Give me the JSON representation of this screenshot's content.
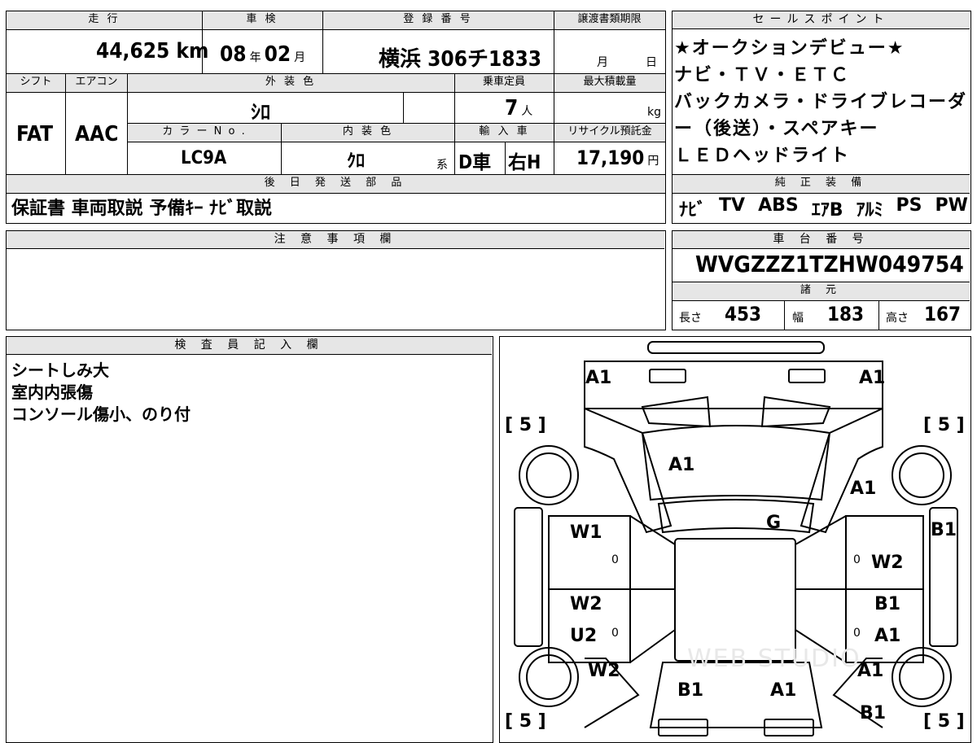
{
  "top": {
    "mileage_label": "走 行",
    "mileage_value": "44,625",
    "mileage_unit": "km",
    "inspection_label": "車 検",
    "inspection_year": "08",
    "inspection_year_unit": "年",
    "inspection_month": "02",
    "inspection_month_unit": "月",
    "registration_label": "登 録 番 号",
    "registration_value": "横浜 306チ1833",
    "transfer_label": "譲渡書類期限",
    "transfer_month_unit": "月",
    "transfer_day_unit": "日"
  },
  "row2": {
    "shift_label": "シフト",
    "shift_value": "FAT",
    "aircon_label": "エアコン",
    "aircon_value": "AAC",
    "exterior_label": "外 装 色",
    "exterior_value": "ｼﾛ",
    "capacity_label": "乗車定員",
    "capacity_value": "7",
    "capacity_unit": "人",
    "maxload_label": "最大積載量",
    "maxload_unit": "kg",
    "colorno_label": "カ ラ ー N o .",
    "colorno_value": "LC9A",
    "interior_label": "内 装 色",
    "interior_value": "ｸﾛ",
    "interior_unit": "系",
    "import_label": "輸 入 車",
    "import_value1": "D車",
    "import_value2": "右H",
    "recycle_label": "リサイクル預託金",
    "recycle_value": "17,190",
    "recycle_unit": "円"
  },
  "later_parts": {
    "label": "後 日 発 送 部 品",
    "value": "保証書 車両取説 予備ｷｰ ﾅﾋﾞ取説"
  },
  "sales_points": {
    "label": "セールスポイント",
    "lines": [
      "★オークションデビュー★",
      "ナビ・ＴＶ・ＥＴＣ",
      "バックカメラ・ドライブレコーダ",
      "ー（後送）・スペアキー",
      "ＬＥＤヘッドライト"
    ]
  },
  "genuine_equipment": {
    "label": "純 正 装 備",
    "items": [
      "ﾅﾋﾞ",
      "TV",
      "ABS",
      "ｴｱB",
      "ｱﾙﾐ",
      "PS",
      "PW"
    ]
  },
  "notes": {
    "label": "注 意 事 項 欄"
  },
  "chassis": {
    "label": "車 台 番 号",
    "value": "WVGZZZ1TZHW049754"
  },
  "specs": {
    "label": "諸 元",
    "length_label": "長さ",
    "length_value": "453",
    "width_label": "幅",
    "width_value": "183",
    "height_label": "高さ",
    "height_value": "167"
  },
  "inspector": {
    "label": "検 査 員 記 入 欄",
    "lines": [
      "シートしみ大",
      "室内内張傷",
      "コンソール傷小、のり付"
    ]
  },
  "diagram": {
    "watermark": "WEB STUDIO",
    "brackets": {
      "tl": "[ 5 ]",
      "tr": "[ 5 ]",
      "bl": "[ 5 ]",
      "br": "[ 5 ]"
    },
    "marks": {
      "front_left": "A1",
      "front_right": "A1",
      "hood": "A1",
      "right_front_fender": "A1",
      "windshield": "G",
      "right_panel": "B1",
      "front_left_door": "W1",
      "front_left_door_zero": "0",
      "front_right_door": "W2",
      "front_right_door_zero": "0",
      "rear_left_door": "W2",
      "rear_left_door_u": "U2",
      "rear_left_door_zero": "0",
      "rear_right_door_b": "B1",
      "rear_right_door_a": "A1",
      "rear_right_door_zero": "0",
      "rear_left_fender": "W2",
      "rear_right_fender": "A1",
      "rear_right_lower": "B1",
      "tailgate_left": "B1",
      "tailgate_right": "A1"
    }
  }
}
